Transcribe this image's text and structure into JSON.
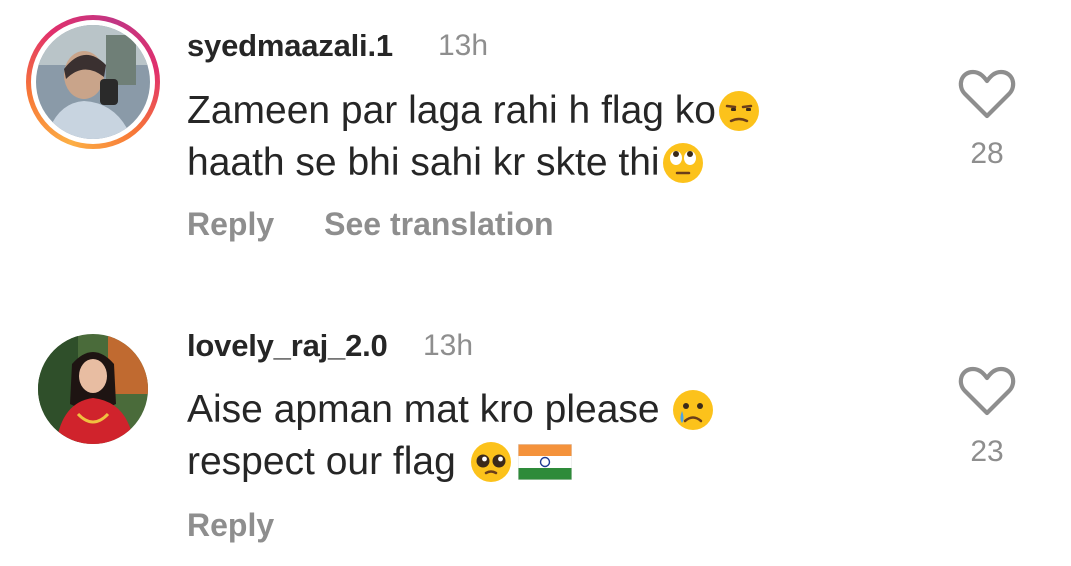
{
  "comments": [
    {
      "username": "syedmaazali.1",
      "time": "13h",
      "lines": [
        "Zameen par laga rahi h flag ko",
        "haath se bhi sahi kr skte thi"
      ],
      "line_emojis": [
        "unamused-face-emoji",
        "face-with-rolling-eyes-emoji"
      ],
      "like_count": "28",
      "actions": {
        "reply": "Reply",
        "translate": "See translation"
      },
      "avatar": "story-ring-avatar"
    },
    {
      "username": "lovely_raj_2.0",
      "time": "13h",
      "lines": [
        "Aise apman mat kro please",
        "respect our flag"
      ],
      "line_emojis": [
        "crying-face-emoji",
        "pleading-face-emoji india-flag-emoji"
      ],
      "like_count": "23",
      "actions": {
        "reply": "Reply"
      },
      "avatar": "plain-avatar"
    }
  ],
  "colors": {
    "text": "#262626",
    "secondary": "#8e8e8e",
    "ring_start": "#fcaf45",
    "ring_end": "#c13584"
  }
}
